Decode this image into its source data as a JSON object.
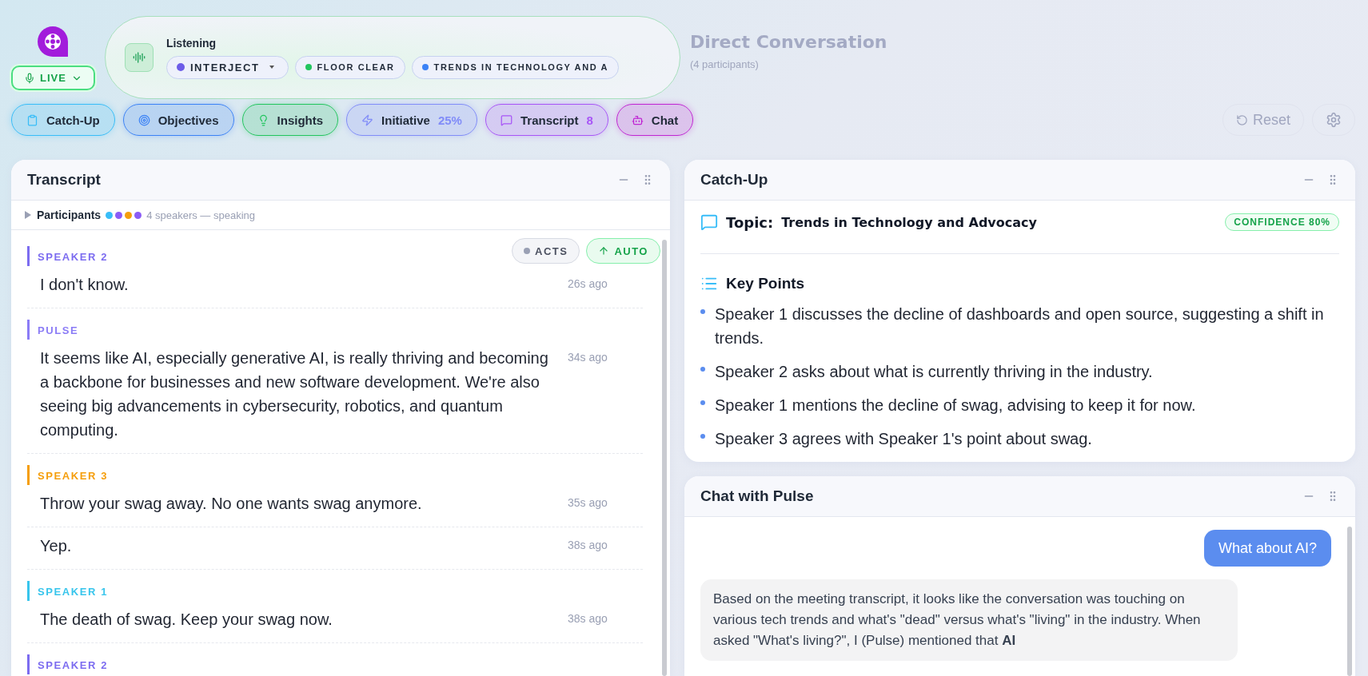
{
  "live_button": {
    "label": "LIVE"
  },
  "status": {
    "label": "Listening",
    "chips": [
      {
        "label": "INTERJECT",
        "color": "#6d5ce8",
        "dropdown": true
      },
      {
        "label": "FLOOR CLEAR",
        "color": "#22c55e",
        "dropdown": false
      },
      {
        "label": "TRENDS IN TECHNOLOGY AND A",
        "color": "#3b82f6",
        "dropdown": false
      }
    ]
  },
  "conversation": {
    "title": "Direct Conversation",
    "subtitle": "(4 participants)"
  },
  "tabs": [
    {
      "kind": "catchup",
      "label": "Catch-Up",
      "color": "#38bdf8"
    },
    {
      "kind": "objectives",
      "label": "Objectives",
      "color": "#3b82f6"
    },
    {
      "kind": "insights",
      "label": "Insights",
      "color": "#22c55e"
    },
    {
      "kind": "initiative",
      "label": "Initiative",
      "badge": "25%",
      "color": "#818cf8"
    },
    {
      "kind": "transcript",
      "label": "Transcript",
      "badge": "8",
      "color": "#a855f7"
    },
    {
      "kind": "chat",
      "label": "Chat",
      "color": "#c026d3"
    }
  ],
  "actions": {
    "reset": "Reset"
  },
  "transcript": {
    "title": "Transcript",
    "participants": {
      "label": "Participants",
      "expanded": false,
      "dots": [
        {
          "color": "#38bdf8"
        },
        {
          "color": "#8b5cf6"
        },
        {
          "color": "#f59e0b"
        },
        {
          "color": "#8b5cf6"
        }
      ],
      "summary": "4 speakers — speaking"
    },
    "toggles": [
      {
        "kind": "acts",
        "label": "ACTS",
        "on": false
      },
      {
        "kind": "auto",
        "label": "AUTO",
        "on": true
      }
    ],
    "groups": [
      {
        "speaker": "SPEAKER 2",
        "color": "#7c6cf0",
        "messages": [
          {
            "text": "I don't know.",
            "time": "26s ago"
          }
        ]
      },
      {
        "speaker": "PULSE",
        "color": "#8b7cf6",
        "messages": [
          {
            "text": "It seems like AI, especially generative AI, is really thriving and becoming a backbone for businesses and new software development. We're also seeing big advancements in cybersecurity, robotics, and quantum computing.",
            "time": "34s ago"
          }
        ]
      },
      {
        "speaker": "SPEAKER 3",
        "color": "#f59e0b",
        "messages": [
          {
            "text": "Throw your swag away. No one wants swag anymore.",
            "time": "35s ago"
          },
          {
            "text": "Yep.",
            "time": "38s ago"
          }
        ]
      },
      {
        "speaker": "SPEAKER 1",
        "color": "#38c5ec",
        "messages": [
          {
            "text": "The death of swag. Keep your swag now.",
            "time": "38s ago"
          }
        ]
      },
      {
        "speaker": "SPEAKER 2",
        "color": "#7c6cf0"
      }
    ]
  },
  "catchup": {
    "title": "Catch-Up",
    "topic_label": "Topic:",
    "topic": "Trends in Technology and Advocacy",
    "confidence": "CONFIDENCE 80%",
    "key_points_title": "Key Points",
    "points": [
      "Speaker 1 discusses the decline of dashboards and open source, suggesting a shift in trends.",
      "Speaker 2 asks about what is currently thriving in the industry.",
      "Speaker 1 mentions the decline of swag, advising to keep it for now.",
      "Speaker 3 agrees with Speaker 1's point about swag."
    ]
  },
  "chat": {
    "title": "Chat with Pulse",
    "messages": [
      {
        "kind": "user",
        "text": "What about AI?"
      },
      {
        "kind": "assistant",
        "text": "Based on the meeting transcript, it looks like the conversation was touching on various tech trends and what's \"dead\" versus what's \"living\" in the industry. When asked \"What's living?\", I (Pulse) mentioned that **AI**"
      }
    ]
  }
}
